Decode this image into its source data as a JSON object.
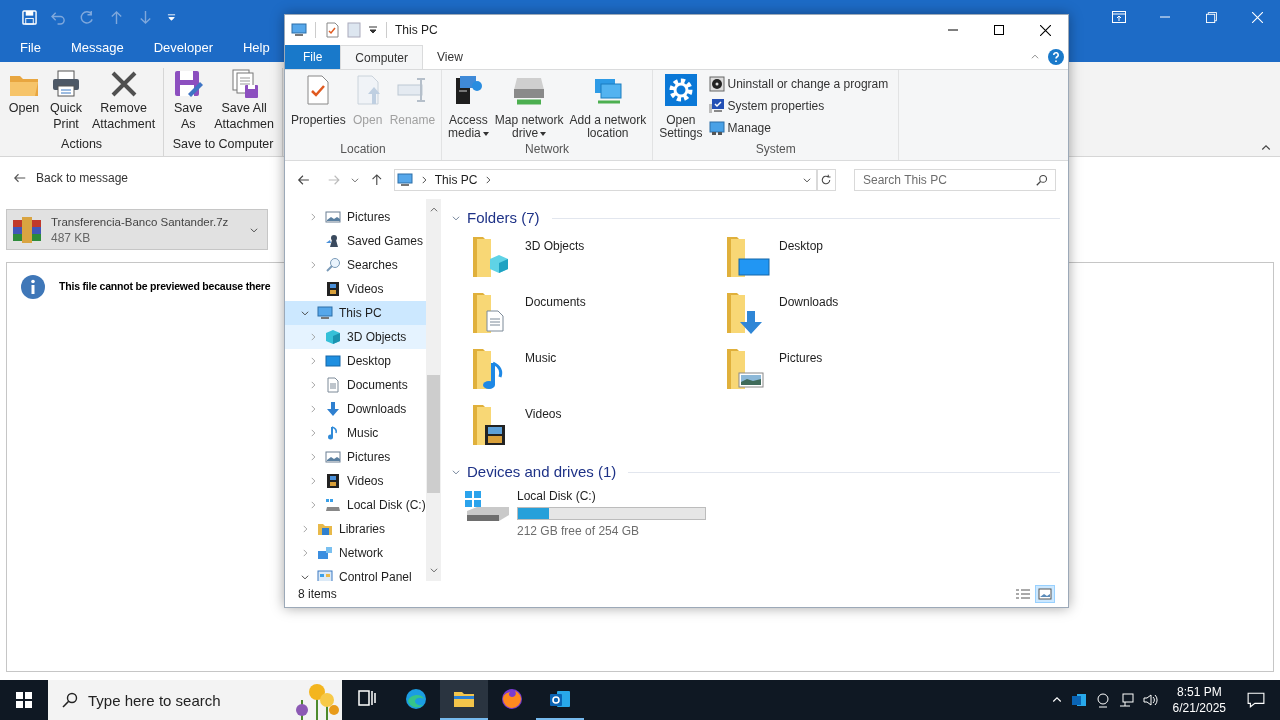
{
  "outlook": {
    "menu_tabs": [
      {
        "label": "File"
      },
      {
        "label": "Message"
      },
      {
        "label": "Developer"
      },
      {
        "label": "Help"
      }
    ],
    "ribbon_groups": [
      {
        "label": "Actions",
        "buttons": [
          {
            "kind": "open",
            "lines": [
              "Open"
            ]
          },
          {
            "kind": "print",
            "lines": [
              "Quick",
              "Print"
            ]
          },
          {
            "kind": "remove",
            "lines": [
              "Remove",
              "Attachment"
            ]
          }
        ]
      },
      {
        "label": "Save to Computer",
        "buttons": [
          {
            "kind": "saveas",
            "lines": [
              "Save",
              "As"
            ]
          },
          {
            "kind": "saveall",
            "lines": [
              "Save All",
              "Attachmen"
            ]
          }
        ]
      }
    ],
    "back_link": "Back to message",
    "attachment": {
      "name": "Transferencia-Banco Santander.7z",
      "size": "487 KB"
    },
    "preview_notice": "This file cannot be previewed because there"
  },
  "explorer": {
    "title": "This PC",
    "tabs": [
      {
        "label": "File",
        "kind": "file",
        "selected": false
      },
      {
        "label": "Computer",
        "kind": "tab",
        "selected": true
      },
      {
        "label": "View",
        "kind": "tab",
        "selected": false
      }
    ],
    "ribbon": [
      {
        "label": "Location",
        "buttons": [
          {
            "kind": "properties",
            "lines": [
              "Properties"
            ],
            "disabled": false,
            "dropdown": false
          },
          {
            "kind": "open",
            "lines": [
              "Open"
            ],
            "disabled": true,
            "dropdown": false
          },
          {
            "kind": "rename",
            "lines": [
              "Rename"
            ],
            "disabled": true,
            "dropdown": false
          }
        ]
      },
      {
        "label": "Network",
        "buttons": [
          {
            "kind": "media",
            "lines": [
              "Access",
              "media"
            ],
            "disabled": false,
            "dropdown": true
          },
          {
            "kind": "mapdrive",
            "lines": [
              "Map network",
              "drive"
            ],
            "disabled": false,
            "dropdown": true
          },
          {
            "kind": "addlocation",
            "lines": [
              "Add a network",
              "location"
            ],
            "disabled": false,
            "dropdown": false
          }
        ]
      },
      {
        "label": "System",
        "buttons": [
          {
            "kind": "settings",
            "lines": [
              "Open",
              "Settings"
            ],
            "disabled": false,
            "dropdown": false
          }
        ],
        "small_buttons": [
          {
            "kind": "uninstall",
            "label": "Uninstall or change a program"
          },
          {
            "kind": "sysprops",
            "label": "System properties"
          },
          {
            "kind": "manage",
            "label": "Manage"
          }
        ]
      }
    ],
    "address": "This PC",
    "search_placeholder": "Search This PC",
    "nav_tree": {
      "scrolled_group": [
        {
          "label": "Pictures",
          "kind": "pictures",
          "expandable": true,
          "expanded": false,
          "selected": false,
          "hovered": false
        },
        {
          "label": "Saved Games",
          "kind": "games",
          "expandable": false,
          "selected": false,
          "hovered": false
        },
        {
          "label": "Searches",
          "kind": "searches",
          "expandable": true,
          "expanded": false,
          "selected": false,
          "hovered": false
        },
        {
          "label": "Videos",
          "kind": "videos",
          "expandable": false,
          "selected": false,
          "hovered": false
        }
      ],
      "items": [
        {
          "label": "This PC",
          "kind": "pc",
          "expandable": true,
          "expanded": true,
          "selected": true,
          "hovered": false,
          "children": [
            {
              "label": "3D Objects",
              "kind": "objects",
              "expandable": true,
              "expanded": false,
              "selected": false,
              "hovered": true
            },
            {
              "label": "Desktop",
              "kind": "desktop",
              "expandable": true,
              "expanded": false,
              "selected": false,
              "hovered": false
            },
            {
              "label": "Documents",
              "kind": "documents",
              "expandable": true,
              "expanded": false,
              "selected": false,
              "hovered": false
            },
            {
              "label": "Downloads",
              "kind": "downloads",
              "expandable": true,
              "expanded": false,
              "selected": false,
              "hovered": false
            },
            {
              "label": "Music",
              "kind": "music",
              "expandable": true,
              "expanded": false,
              "selected": false,
              "hovered": false
            },
            {
              "label": "Pictures",
              "kind": "pictures",
              "expandable": true,
              "expanded": false,
              "selected": false,
              "hovered": false
            },
            {
              "label": "Videos",
              "kind": "videos",
              "expandable": true,
              "expanded": false,
              "selected": false,
              "hovered": false
            },
            {
              "label": "Local Disk (C:)",
              "kind": "disk",
              "expandable": true,
              "expanded": false,
              "selected": false,
              "hovered": false
            }
          ]
        },
        {
          "label": "Libraries",
          "kind": "libraries",
          "expandable": true,
          "expanded": false,
          "selected": false,
          "hovered": false
        },
        {
          "label": "Network",
          "kind": "network",
          "expandable": true,
          "expanded": false,
          "selected": false,
          "hovered": false
        },
        {
          "label": "Control Panel",
          "kind": "controlpanel",
          "expandable": true,
          "expanded": true,
          "selected": false,
          "hovered": false
        }
      ]
    },
    "sections": [
      {
        "title": "Folders (7)",
        "expanded": true,
        "kind": "folders",
        "items": [
          {
            "label": "3D Objects",
            "kind": "objects"
          },
          {
            "label": "Desktop",
            "kind": "desktop"
          },
          {
            "label": "Documents",
            "kind": "documents"
          },
          {
            "label": "Downloads",
            "kind": "downloads"
          },
          {
            "label": "Music",
            "kind": "music"
          },
          {
            "label": "Pictures",
            "kind": "pictures"
          },
          {
            "label": "Videos",
            "kind": "videos"
          }
        ]
      },
      {
        "title": "Devices and drives (1)",
        "expanded": true,
        "kind": "drives",
        "items": [
          {
            "label": "Local Disk (C:)",
            "level": 0.165,
            "free": "212 GB free of 254 GB"
          }
        ]
      }
    ],
    "status": "8 items",
    "views": [
      {
        "kind": "details",
        "selected": false
      },
      {
        "kind": "largeicons",
        "selected": true
      }
    ]
  },
  "taskbar": {
    "search_placeholder": "Type here to search",
    "apps": [
      {
        "kind": "taskview",
        "active": false,
        "running": false
      },
      {
        "kind": "edge",
        "active": false,
        "running": false
      },
      {
        "kind": "explorer",
        "active": true,
        "running": true
      },
      {
        "kind": "firefox",
        "active": false,
        "running": false
      },
      {
        "kind": "outlook",
        "active": false,
        "running": true
      }
    ],
    "time": "8:51 PM",
    "date": "6/21/2025"
  }
}
